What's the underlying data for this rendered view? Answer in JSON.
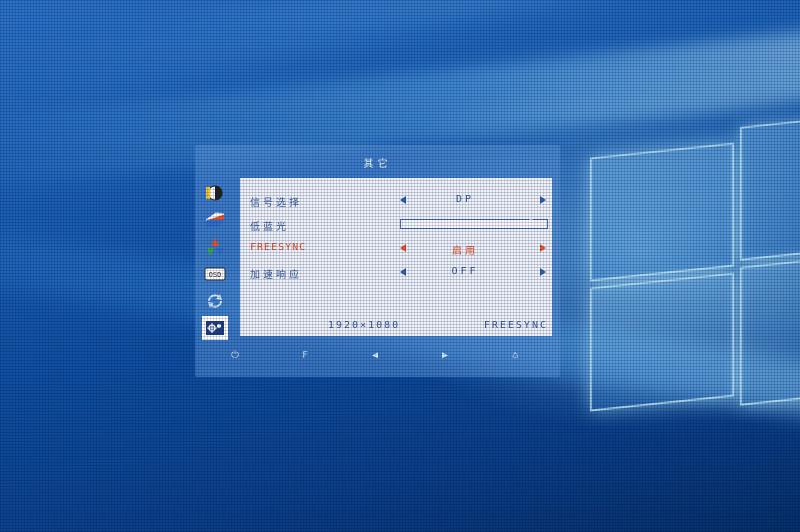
{
  "osd": {
    "title": "其它",
    "menu_icons": [
      {
        "name": "brightness-contrast-icon",
        "selected": false
      },
      {
        "name": "display-mode-icon",
        "selected": false
      },
      {
        "name": "color-rgb-icon",
        "selected": false
      },
      {
        "name": "osd-settings-icon",
        "selected": false
      },
      {
        "name": "reset-icon",
        "selected": false
      },
      {
        "name": "other-settings-icon",
        "selected": true
      }
    ],
    "rows": [
      {
        "label": "信号选择",
        "value": "DP",
        "type": "select"
      },
      {
        "label": "低蓝光",
        "value": "0",
        "type": "slider",
        "level": 0
      },
      {
        "label": "FREESYNC",
        "value": "启用",
        "type": "select",
        "active": true
      },
      {
        "label": "加速响应",
        "value": "OFF",
        "type": "select"
      }
    ],
    "status": {
      "resolution": "1920×1080",
      "mode": "FREESYNC"
    },
    "keys": [
      {
        "name": "power-key-icon",
        "glyph": "⏻"
      },
      {
        "name": "f-key-icon",
        "glyph": "F"
      },
      {
        "name": "left-key-icon",
        "glyph": "◀"
      },
      {
        "name": "right-key-icon",
        "glyph": "▶"
      },
      {
        "name": "menu-key-icon",
        "glyph": "⌂"
      }
    ],
    "colors": {
      "accent": "#e8542e",
      "text": "#3a5fa0",
      "panel": "#eef2fa"
    }
  }
}
